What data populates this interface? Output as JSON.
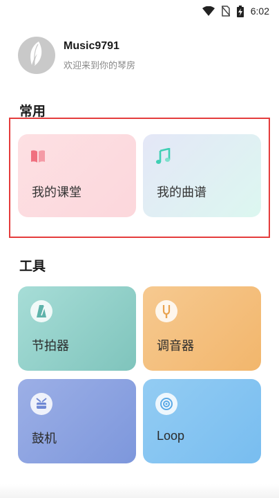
{
  "status_bar": {
    "time": "6:02",
    "icons": [
      "wifi-icon",
      "no-sim-icon",
      "battery-charging-icon"
    ]
  },
  "profile": {
    "username": "Music9791",
    "welcome": "欢迎来到你的琴房",
    "avatar_icon": "feather-logo-icon"
  },
  "sections": {
    "common_title": "常用",
    "tools_title": "工具"
  },
  "common_cards": [
    {
      "label": "我的课堂",
      "icon": "book-icon",
      "icon_color": "#f0707f"
    },
    {
      "label": "我的曲谱",
      "icon": "music-note-icon",
      "icon_color": "#3fcfb4"
    }
  ],
  "tool_cards": [
    {
      "label": "节拍器",
      "icon": "metronome-icon"
    },
    {
      "label": "调音器",
      "icon": "tuning-fork-icon"
    },
    {
      "label": "鼓机",
      "icon": "drum-icon"
    },
    {
      "label": "Loop",
      "icon": "loop-icon"
    }
  ],
  "colors": {
    "highlight_border": "#e43b3b",
    "classroom_card": "#fcd7dc",
    "scores_card": "#dcf7f0",
    "metronome_card": "#7fc4bc",
    "tuner_card": "#f2b66c",
    "drum_card": "#7d97dc",
    "loop_card": "#78bdf0"
  }
}
